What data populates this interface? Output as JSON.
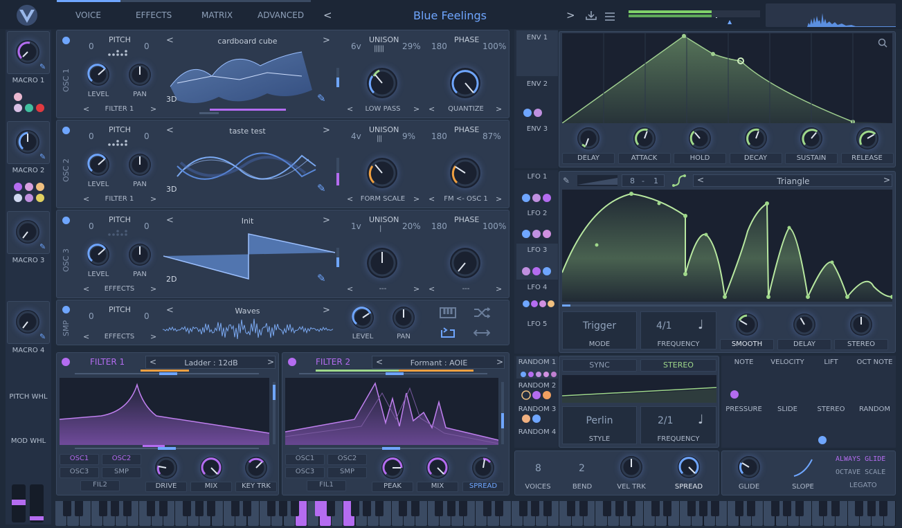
{
  "nav": {
    "tabs": [
      "VOICE",
      "EFFECTS",
      "MATRIX",
      "ADVANCED"
    ],
    "preset": "Blue Feelings"
  },
  "macros": [
    "MACRO 1",
    "MACRO 2",
    "MACRO 3",
    "MACRO 4"
  ],
  "wheels": {
    "pitch": "PITCH WHL",
    "mod": "MOD WHL"
  },
  "osc": [
    {
      "label": "OSC 1",
      "pitch_l": "0",
      "pitch_r": "0",
      "pitch": "PITCH",
      "wave": "cardboard cube",
      "mode": "3D",
      "level": "LEVEL",
      "pan": "PAN",
      "route": "FILTER 1",
      "unison_v": "6v",
      "unison": "UNISON",
      "unison_pct": "29%",
      "phase_v": "180",
      "phase": "PHASE",
      "phase_pct": "100%",
      "mod1": "LOW PASS",
      "mod2": "QUANTIZE"
    },
    {
      "label": "OSC 2",
      "pitch_l": "0",
      "pitch_r": "0",
      "pitch": "PITCH",
      "wave": "taste test",
      "mode": "3D",
      "level": "LEVEL",
      "pan": "PAN",
      "route": "FILTER 1",
      "unison_v": "4v",
      "unison": "UNISON",
      "unison_pct": "9%",
      "phase_v": "180",
      "phase": "PHASE",
      "phase_pct": "87%",
      "mod1": "FORM SCALE",
      "mod2": "FM <- OSC 1"
    },
    {
      "label": "OSC 3",
      "pitch_l": "0",
      "pitch_r": "0",
      "pitch": "PITCH",
      "wave": "Init",
      "mode": "2D",
      "level": "LEVEL",
      "pan": "PAN",
      "route": "EFFECTS",
      "unison_v": "1v",
      "unison": "UNISON",
      "unison_pct": "20%",
      "phase_v": "180",
      "phase": "PHASE",
      "phase_pct": "100%",
      "mod1": "---",
      "mod2": "---"
    }
  ],
  "smp": {
    "label": "SMP",
    "pitch": "PITCH",
    "pitch_l": "0",
    "pitch_r": "0",
    "wave": "Waves",
    "route": "EFFECTS",
    "level": "LEVEL",
    "pan": "PAN"
  },
  "filter1": {
    "title": "FILTER 1",
    "type": "Ladder : 12dB",
    "srcs": [
      "OSC1",
      "OSC2",
      "OSC3",
      "SMP",
      "FIL2"
    ],
    "k": [
      "DRIVE",
      "MIX",
      "KEY TRK"
    ]
  },
  "filter2": {
    "title": "FILTER 2",
    "type": "Formant : AOIE",
    "srcs": [
      "OSC1",
      "OSC2",
      "OSC3",
      "SMP",
      "FIL1"
    ],
    "k": [
      "PEAK",
      "MIX",
      "SPREAD"
    ]
  },
  "env": {
    "tabs": [
      "ENV 1",
      "ENV 2",
      "ENV 3"
    ],
    "k": [
      "DELAY",
      "ATTACK",
      "HOLD",
      "DECAY",
      "SUSTAIN",
      "RELEASE"
    ]
  },
  "lfo": {
    "tabs": [
      "LFO 1",
      "LFO 2",
      "LFO 3",
      "LFO 4",
      "LFO 5"
    ],
    "div_a": "8",
    "div_sep": "-",
    "div_b": "1",
    "shape": "Triangle",
    "mode_v": "Trigger",
    "mode": "MODE",
    "freq_v": "4/1",
    "freq": "FREQUENCY",
    "k": [
      "SMOOTH",
      "DELAY",
      "STEREO"
    ]
  },
  "random": {
    "tabs": [
      "RANDOM 1",
      "RANDOM 2",
      "RANDOM 3",
      "RANDOM 4"
    ],
    "sync": "SYNC",
    "stereo": "STEREO",
    "style_v": "Perlin",
    "style": "STYLE",
    "freq_v": "2/1",
    "freq": "FREQUENCY"
  },
  "modsrc": [
    "NOTE",
    "VELOCITY",
    "LIFT",
    "OCT NOTE",
    "PRESSURE",
    "SLIDE",
    "STEREO",
    "RANDOM"
  ],
  "voice": {
    "voices_v": "8",
    "voices": "VOICES",
    "bend_v": "2",
    "bend": "BEND",
    "veltrk": "VEL TRK",
    "spread": "SPREAD",
    "glide": "GLIDE",
    "slope": "SLOPE",
    "always": "ALWAYS GLIDE",
    "octave": "OCTAVE SCALE",
    "legato": "LEGATO"
  },
  "colors": {
    "accent": "#6fa6ff",
    "purple": "#b46cf0",
    "green": "#9fd88a",
    "orange": "#f0a040"
  }
}
